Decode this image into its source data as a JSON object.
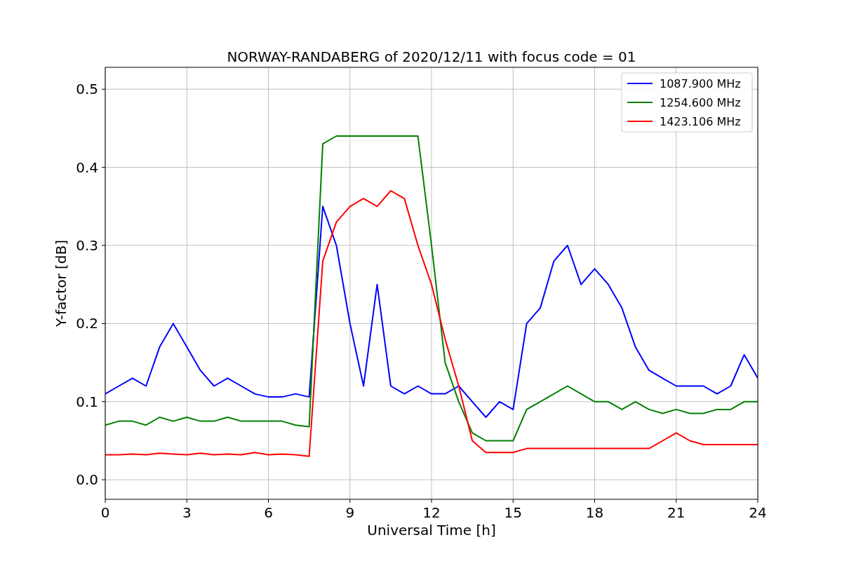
{
  "figure": {
    "chart_data": {
      "type": "line",
      "title": "NORWAY-RANDABERG of 2020/12/11 with focus code = 01",
      "xlabel": "Universal Time [h]",
      "ylabel": "Y-factor [dB]",
      "x": [
        0,
        0.5,
        1,
        1.5,
        2,
        2.5,
        3,
        3.5,
        4,
        4.5,
        5,
        5.5,
        6,
        6.5,
        7,
        7.5,
        8,
        8.5,
        9,
        9.5,
        10,
        10.5,
        11,
        11.5,
        12,
        12.5,
        13,
        13.5,
        14,
        14.5,
        15,
        15.5,
        16,
        16.5,
        17,
        17.5,
        18,
        18.5,
        19,
        19.5,
        20,
        20.5,
        21,
        21.5,
        22,
        22.5,
        23,
        23.5,
        24
      ],
      "series": [
        {
          "name": "1087.900 MHz",
          "color": "#0000ff",
          "values": [
            0.11,
            0.12,
            0.13,
            0.12,
            0.17,
            0.2,
            0.17,
            0.14,
            0.12,
            0.13,
            0.12,
            0.11,
            0.106,
            0.106,
            0.11,
            0.106,
            0.35,
            0.3,
            0.2,
            0.12,
            0.25,
            0.12,
            0.11,
            0.12,
            0.11,
            0.11,
            0.12,
            0.1,
            0.08,
            0.1,
            0.09,
            0.2,
            0.22,
            0.28,
            0.3,
            0.25,
            0.27,
            0.25,
            0.22,
            0.17,
            0.14,
            0.13,
            0.12,
            0.12,
            0.12,
            0.11,
            0.12,
            0.16,
            0.13
          ]
        },
        {
          "name": "1254.600 MHz",
          "color": "#008000",
          "values": [
            0.07,
            0.075,
            0.075,
            0.07,
            0.08,
            0.075,
            0.08,
            0.075,
            0.075,
            0.08,
            0.075,
            0.075,
            0.075,
            0.075,
            0.07,
            0.068,
            0.43,
            0.44,
            0.44,
            0.44,
            0.44,
            0.44,
            0.44,
            0.44,
            0.3,
            0.15,
            0.1,
            0.06,
            0.05,
            0.05,
            0.05,
            0.09,
            0.1,
            0.11,
            0.12,
            0.11,
            0.1,
            0.1,
            0.09,
            0.1,
            0.09,
            0.085,
            0.09,
            0.085,
            0.085,
            0.09,
            0.09,
            0.1,
            0.1
          ]
        },
        {
          "name": "1423.106 MHz",
          "color": "#ff0000",
          "values": [
            0.032,
            0.032,
            0.033,
            0.032,
            0.034,
            0.033,
            0.032,
            0.034,
            0.032,
            0.033,
            0.032,
            0.035,
            0.032,
            0.033,
            0.032,
            0.03,
            0.28,
            0.33,
            0.35,
            0.36,
            0.35,
            0.37,
            0.36,
            0.3,
            0.25,
            0.18,
            0.12,
            0.05,
            0.035,
            0.035,
            0.035,
            0.04,
            0.04,
            0.04,
            0.04,
            0.04,
            0.04,
            0.04,
            0.04,
            0.04,
            0.04,
            0.05,
            0.06,
            0.05,
            0.045,
            0.045,
            0.045,
            0.045,
            0.045
          ]
        }
      ],
      "grid": true,
      "legend": true,
      "xlim": [
        0,
        24
      ],
      "ylim": [
        -0.025,
        0.528
      ],
      "xticks": [
        0,
        3,
        6,
        9,
        12,
        15,
        18,
        21,
        24
      ],
      "yticks": [
        {
          "value": 0,
          "label": "0.0"
        },
        {
          "value": 0.1,
          "label": "0.1"
        },
        {
          "value": 0.2,
          "label": "0.2"
        },
        {
          "value": 0.3,
          "label": "0.3"
        },
        {
          "value": 0.4,
          "label": "0.4"
        },
        {
          "value": 0.5,
          "label": "0.5"
        }
      ]
    }
  }
}
